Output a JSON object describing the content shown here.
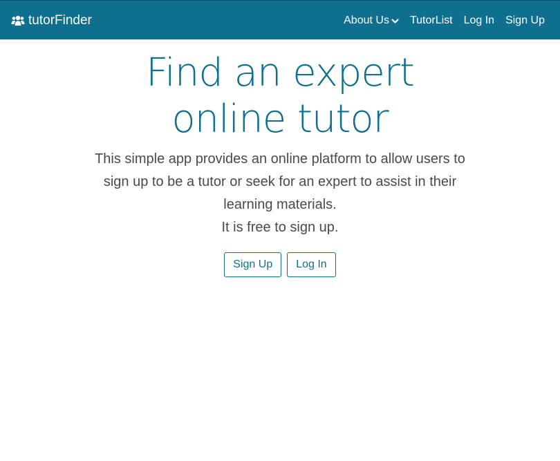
{
  "brand": {
    "icon": "users-icon",
    "name": "tutorFinder"
  },
  "nav": {
    "about_label": "About Us",
    "about_icon": "chevron-down-icon",
    "tutorlist_label": "TutorList",
    "login_label": "Log In",
    "signup_label": "Sign Up"
  },
  "hero": {
    "title": "Find an expert online tutor",
    "description": "This simple app provides an online platform to allow users to sign up to be a tutor or seek for an expert to assist in their learning materials.",
    "free_text": "It is free to sign up.",
    "signup_button": "Sign Up",
    "login_button": "Log In"
  },
  "colors": {
    "navbar": "#0f6f8f",
    "accent": "#0f6f8f",
    "text": "#444b52"
  }
}
